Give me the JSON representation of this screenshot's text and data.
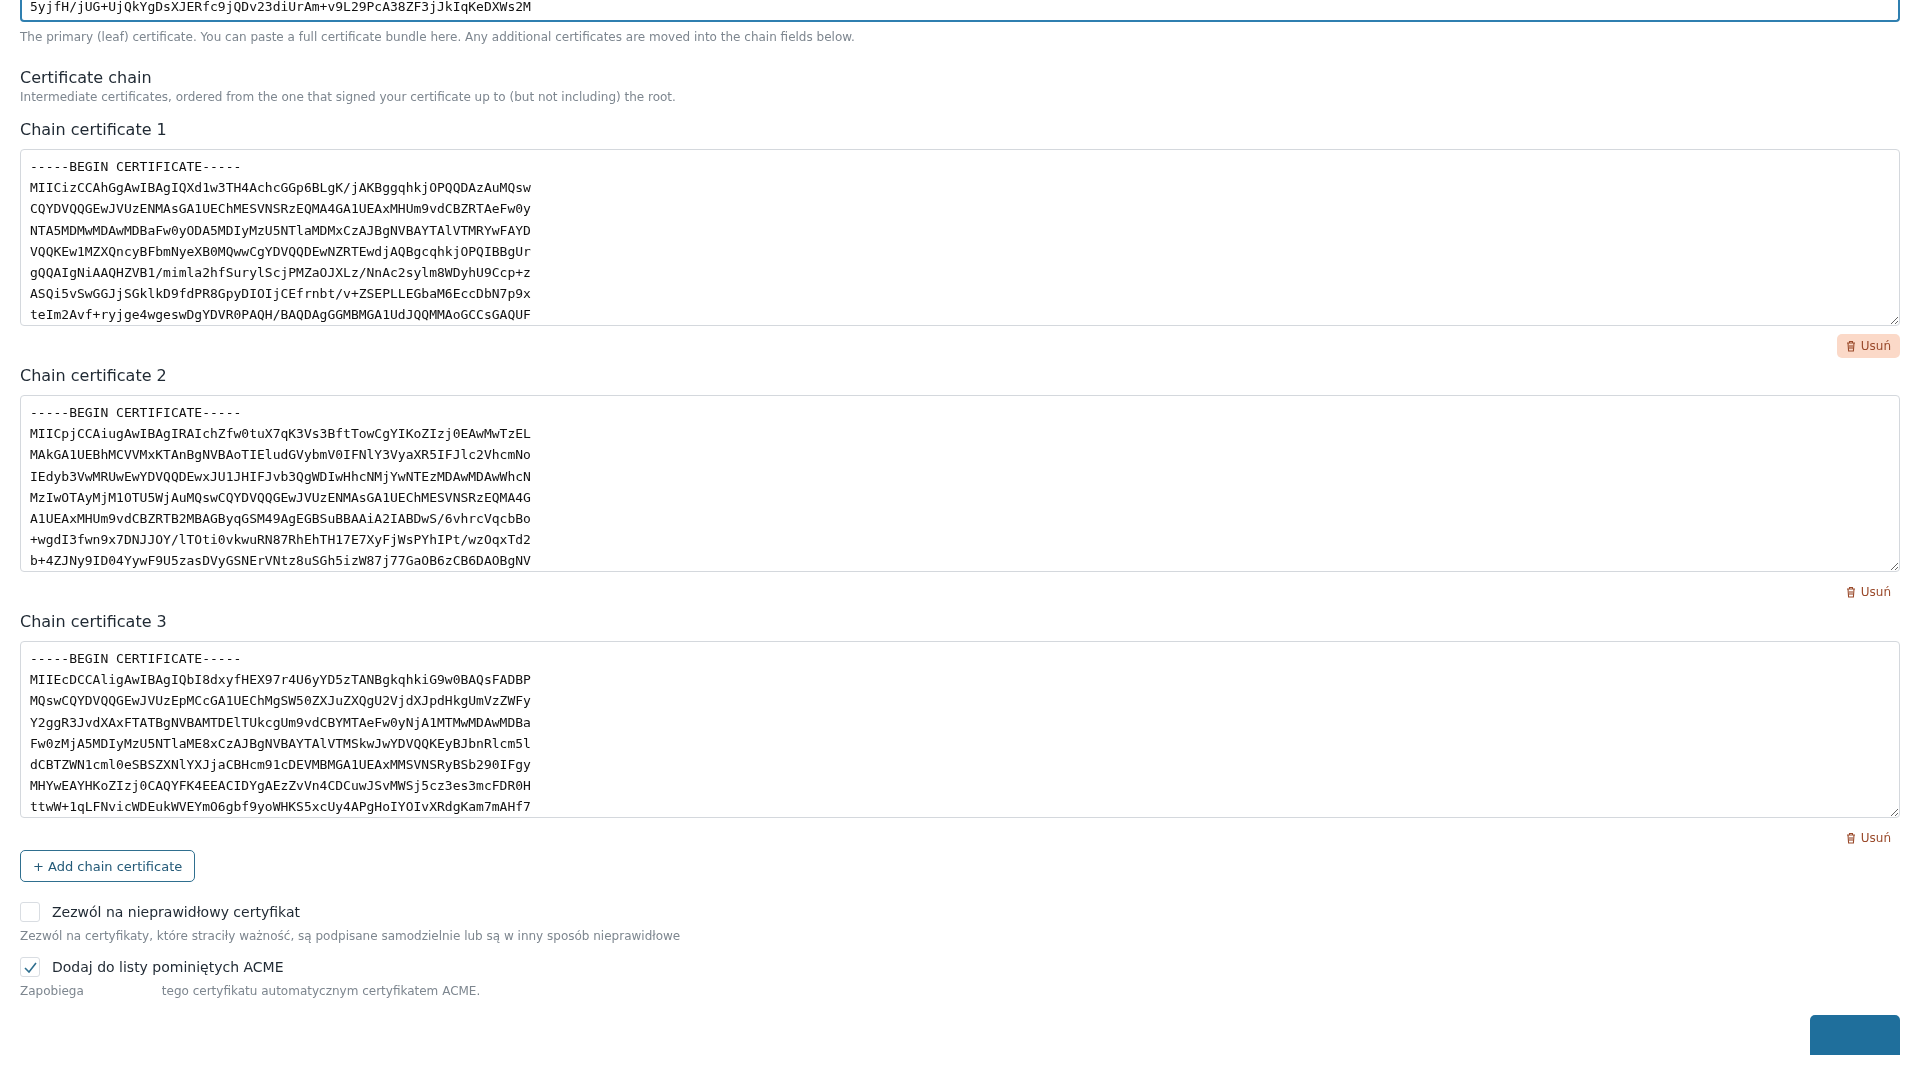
{
  "leaf_certificate": {
    "visible_line": "5yjfH/jUG+UjQkYgDsXJERfc9jQDv23diUrAm+v9L29PcA38ZF3jJkIqKeDXWs2M",
    "focused": true,
    "help": "The primary (leaf) certificate. You can paste a full certificate bundle here. Any additional certificates are moved into the chain fields below."
  },
  "chain": {
    "title": "Certificate chain",
    "description": "Intermediate certificates, ordered from the one that signed your certificate up to (but not including) the root.",
    "certificates": [
      {
        "label": "Chain certificate 1",
        "lines": [
          "-----BEGIN CERTIFICATE-----",
          "MIICizCCAhGgAwIBAgIQXd1w3TH4AchcGGp6BLgK/jAKBggqhkjOPQQDAzAuMQsw",
          "CQYDVQQGEwJVUzENMAsGA1UEChMESVNSRzEQMA4GA1UEAxMHUm9vdCBZRTAeFw0y",
          "NTA5MDMwMDAwMDBaFw0yODA5MDIyMzU5NTlaMDMxCzAJBgNVBAYTAlVTMRYwFAYD",
          "VQQKEw1MZXQncyBFbmNyeXB0MQwwCgYDVQQDEwNZRTEwdjAQBgcqhkjOPQIBBgUr",
          "gQQAIgNiAAQHZVB1/mimla2hfSurylScjPMZaOJXLz/NnAc2sylm8WDyhU9Ccp+z",
          "ASQi5vSwGGJjSGklkD9fdPR8GpyDIOIjCEfrnbt/v+ZSEPLLEGbaM6EccDbN7p9x",
          "teIm2Avf+ryjge4wgeswDgYDVR0PAQH/BAQDAgGGMBMGA1UdJQQMMAoGCCsGAQUF"
        ],
        "delete": {
          "label": "Usuń",
          "highlighted": true
        }
      },
      {
        "label": "Chain certificate 2",
        "lines": [
          "-----BEGIN CERTIFICATE-----",
          "MIICpjCCAiugAwIBAgIRAIchZfw0tuX7qK3Vs3BftTowCgYIKoZIzj0EAwMwTzEL",
          "MAkGA1UEBhMCVVMxKTAnBgNVBAoTIEludGVybmV0IFNlY3VyaXR5IFJlc2VhcmNo",
          "IEdyb3VwMRUwEwYDVQQDEwxJU1JHIFJvb3QgWDIwHhcNMjYwNTEzMDAwMDAwWhcN",
          "MzIwOTAyMjM1OTU5WjAuMQswCQYDVQQGEwJVUzENMAsGA1UEChMESVNSRzEQMA4G",
          "A1UEAxMHUm9vdCBZRTB2MBAGByqGSM49AgEGBSuBBAAiA2IABDwS/6vhrcVqcbBo",
          "+wgdI3fwn9x7DNJJOY/lTOti0vkwuRN87RhEhTH17E7XyFjWsPYhIPt/wzOqxTd2",
          "b+4ZJNy9ID04YywF9U5zasDVyGSNErVNtz8uSGh5izW87j77GaOB6zCB6DAOBgNV"
        ],
        "delete": {
          "label": "Usuń",
          "highlighted": false
        }
      },
      {
        "label": "Chain certificate 3",
        "lines": [
          "-----BEGIN CERTIFICATE-----",
          "MIIEcDCCAligAwIBAgIQbI8dxyfHEX97r4U6yYD5zTANBgkqhkiG9w0BAQsFADBP",
          "MQswCQYDVQQGEwJVUzEpMCcGA1UEChMgSW50ZXJuZXQgU2VjdXJpdHkgUmVzZWFy",
          "Y2ggR3JvdXAxFTATBgNVBAMTDElTUkcgUm9vdCBYMTAeFw0yNjA1MTMwMDAwMDBa",
          "Fw0zMjA5MDIyMzU5NTlaME8xCzAJBgNVBAYTAlVTMSkwJwYDVQQKEyBJbnRlcm5l",
          "dCBTZWN1cml0eSBSZXNlYXJjaCBHcm91cDEVMBMGA1UEAxMMSVNSRyBSb290IFgy",
          "MHYwEAYHKoZIzj0CAQYFK4EEACIDYgAEzZvVn4CDCuwJSvMWSj5cz3es3mcFDR0H",
          "ttwW+1qLFNvicWDEukWVEYmO6gbf9yoWHKS5xcUy4APgHoIYOIvXRdgKam7mAHf7"
        ],
        "delete": {
          "label": "Usuń",
          "highlighted": false
        }
      }
    ],
    "add_button": "+ Add chain certificate"
  },
  "options": [
    {
      "label": "Zezwól na nieprawidłowy certyfikat",
      "checked": false,
      "help": [
        "Zezwól na certyfikaty, które straciły ważność, są podpisane samodzielnie lub są w inny sposób nieprawidłowe"
      ]
    },
    {
      "label": "Dodaj do listy pominiętych ACME",
      "checked": true,
      "help": [
        "Zapobiega",
        "tego certyfikatu automatycznym certyfikatem ACME."
      ]
    }
  ]
}
